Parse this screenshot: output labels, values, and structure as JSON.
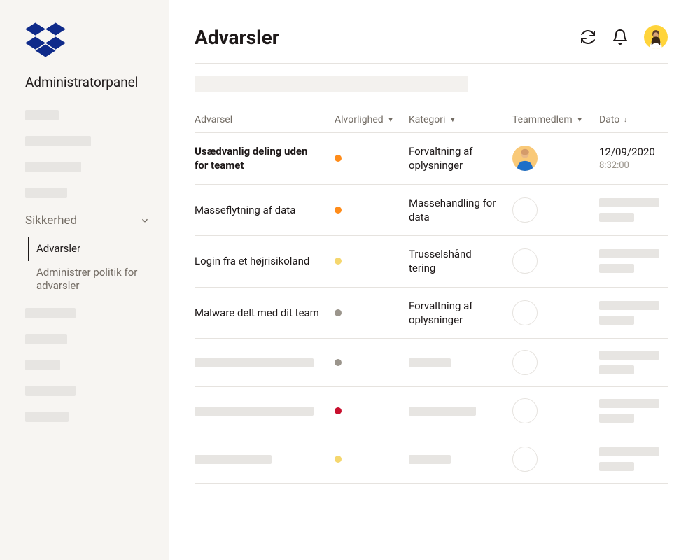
{
  "sidebar": {
    "panel_title": "Administratorpanel",
    "section": {
      "label": "Sikkerhed",
      "items": [
        {
          "label": "Advarsler",
          "active": true
        },
        {
          "label": "Administrer politik for advarsler",
          "active": false
        }
      ]
    }
  },
  "header": {
    "title": "Advarsler"
  },
  "table": {
    "columns": {
      "advarsel": "Advarsel",
      "alvorlighed": "Alvorlighed",
      "kategori": "Kategori",
      "teammedlem": "Teammedlem",
      "dato": "Dato"
    },
    "rows": [
      {
        "advarsel": "Usædvanlig deling uden for teamet",
        "bold": true,
        "severity_color": "#ff8c1a",
        "kategori": "Forvaltning af oplysninger",
        "team_has_avatar": true,
        "dato": "12/09/2020",
        "tid": "8:32:00"
      },
      {
        "advarsel": "Masseflytning af data",
        "bold": false,
        "severity_color": "#ff8c1a",
        "kategori": "Massehandling for data",
        "team_has_avatar": false,
        "dato": "",
        "tid": ""
      },
      {
        "advarsel": "Login fra et højrisikoland",
        "bold": false,
        "severity_color": "#f5d76e",
        "kategori": "Trusselshånd tering",
        "team_has_avatar": false,
        "dato": "",
        "tid": ""
      },
      {
        "advarsel": "Malware delt med dit team",
        "bold": false,
        "severity_color": "#9b958c",
        "kategori": "Forvaltning af oplysninger",
        "team_has_avatar": false,
        "dato": "",
        "tid": ""
      },
      {
        "advarsel": "",
        "bold": false,
        "severity_color": "#9b958c",
        "kategori": "",
        "team_has_avatar": false,
        "dato": "",
        "tid": ""
      },
      {
        "advarsel": "",
        "bold": false,
        "severity_color": "#c8102e",
        "kategori": "",
        "team_has_avatar": false,
        "dato": "",
        "tid": ""
      },
      {
        "advarsel": "",
        "bold": false,
        "severity_color": "#f5d76e",
        "kategori": "",
        "team_has_avatar": false,
        "dato": "",
        "tid": ""
      }
    ]
  }
}
